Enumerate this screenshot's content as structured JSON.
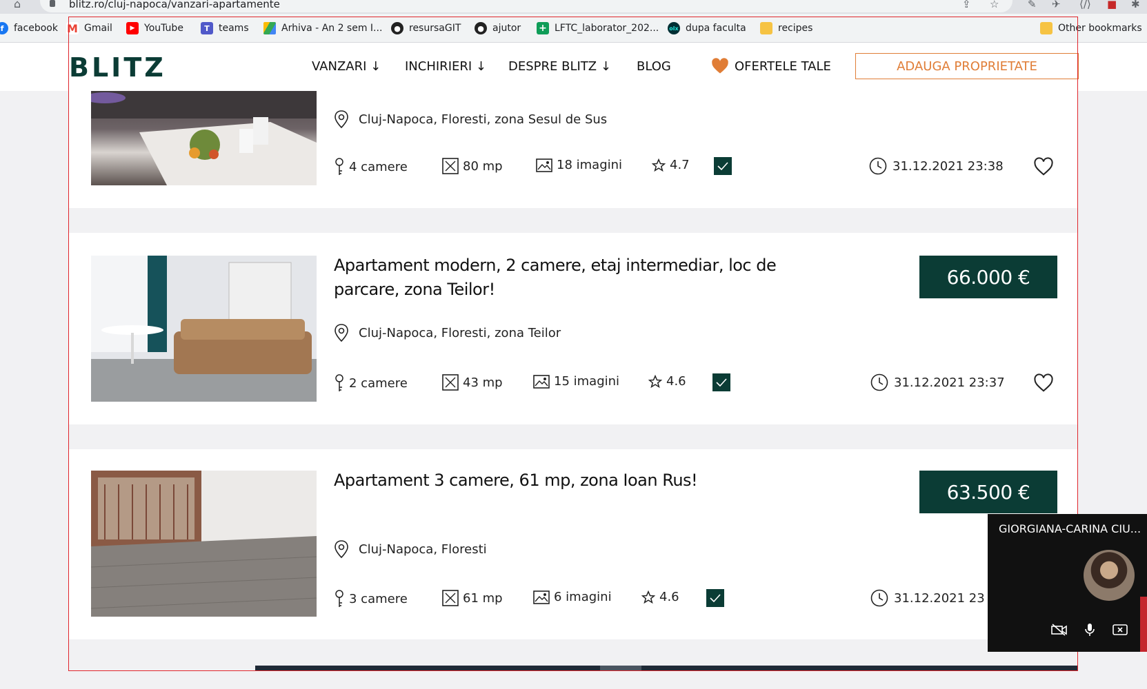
{
  "browser": {
    "url": "blitz.ro/cluj-napoca/vanzari-apartamente",
    "bookmarks": [
      {
        "label": "facebook",
        "icon": "facebook-icon",
        "color": "#1877f2"
      },
      {
        "label": "Gmail",
        "icon": "gmail-icon",
        "color": "#ea4335"
      },
      {
        "label": "YouTube",
        "icon": "youtube-icon",
        "color": "#ff0000"
      },
      {
        "label": "teams",
        "icon": "teams-icon",
        "color": "#5059c9"
      },
      {
        "label": "Arhiva - An 2 sem I...",
        "icon": "google-drive-icon",
        "color": "#34a853"
      },
      {
        "label": "resursaGIT",
        "icon": "github-icon",
        "color": "#222222"
      },
      {
        "label": "ajutor",
        "icon": "github-icon",
        "color": "#222222"
      },
      {
        "label": "LFTC_laborator_202...",
        "icon": "plus-doc-icon",
        "color": "#0f9d58"
      },
      {
        "label": "dupa faculta",
        "icon": "olx-icon",
        "color": "#23e5db"
      },
      {
        "label": "recipes",
        "icon": "folder-icon",
        "color": "#f6c343"
      },
      {
        "label": "Other bookmarks",
        "icon": "folder-icon",
        "color": "#f6c343"
      }
    ]
  },
  "site": {
    "logo": "BLITZ",
    "brand_color": "#0b3c35",
    "accent_color": "#e07d36",
    "nav": {
      "vanzari": "VANZARI ↓",
      "inchirieri": "INCHIRIERI ↓",
      "despre": "DESPRE BLITZ ↓",
      "blog": "BLOG",
      "ofertele": "OFERTELE TALE",
      "adauga": "ADAUGA PROPRIETATE"
    }
  },
  "listings": [
    {
      "title": "",
      "location": "Cluj-Napoca, Floresti, zona Sesul de Sus",
      "rooms": "4 camere",
      "area": "80 mp",
      "images": "18 imagini",
      "rating": "4.7",
      "date": "31.12.2021 23:38",
      "price": ""
    },
    {
      "title": "Apartament modern, 2 camere, etaj intermediar, loc de parcare, zona Teilor!",
      "location": "Cluj-Napoca, Floresti, zona Teilor",
      "rooms": "2 camere",
      "area": "43 mp",
      "images": "15 imagini",
      "rating": "4.6",
      "date": "31.12.2021 23:37",
      "price": "66.000 €"
    },
    {
      "title": "Apartament 3 camere, 61 mp, zona Ioan Rus!",
      "location": "Cluj-Napoca, Floresti",
      "rooms": "3 camere",
      "area": "61 mp",
      "images": "6 imagini",
      "rating": "4.6",
      "date": "31.12.2021 23",
      "price": "63.500 €"
    }
  ],
  "video_call": {
    "participant": "GIORGIANA-CARINA CIU..."
  }
}
